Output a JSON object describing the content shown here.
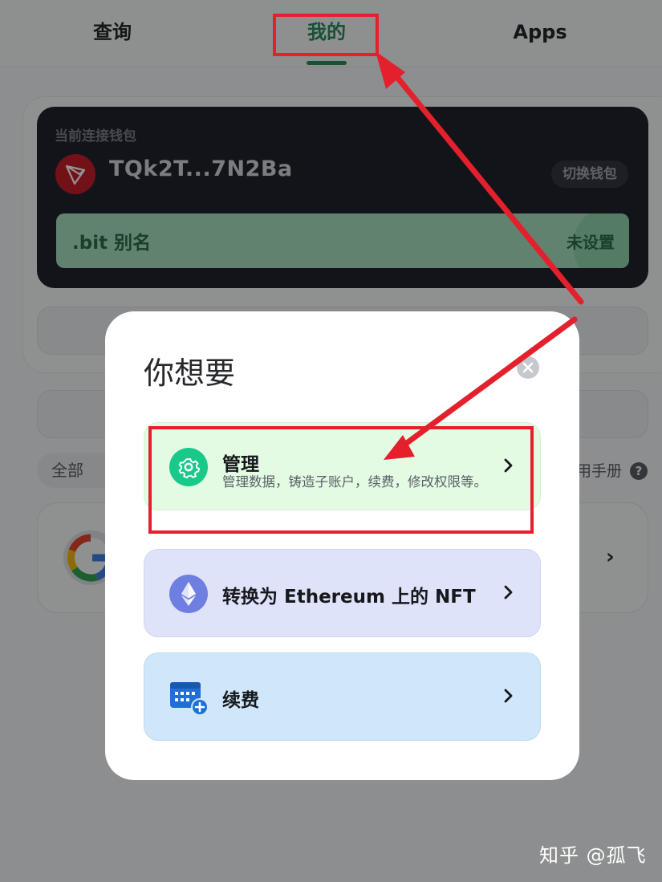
{
  "nav": {
    "tabs": [
      {
        "label": "查询"
      },
      {
        "label": "我的",
        "active": true
      },
      {
        "label": "Apps"
      }
    ]
  },
  "wallet": {
    "caption": "当前连接钱包",
    "address": "TQk2T...7N2Ba",
    "switch_label": "切换钱包",
    "alias_label": ".bit 别名",
    "alias_value": "未设置"
  },
  "filters": {
    "all_label": "全部",
    "manual_label": "用手册",
    "help_icon": "?"
  },
  "modal": {
    "title": "你想要",
    "options": [
      {
        "icon": "gear-icon",
        "title": "管理",
        "description": "管理数据，铸造子账户，续费，修改权限等。",
        "color": "#19c98a"
      },
      {
        "icon": "ethereum-icon",
        "title": "转换为 Ethereum 上的 NFT",
        "color": "#6f7fe1"
      },
      {
        "icon": "calendar-add-icon",
        "title": "续费",
        "color": "#1f6fd6"
      }
    ]
  },
  "annotation_color": "#e3202c",
  "watermark": "知乎 @孤飞"
}
